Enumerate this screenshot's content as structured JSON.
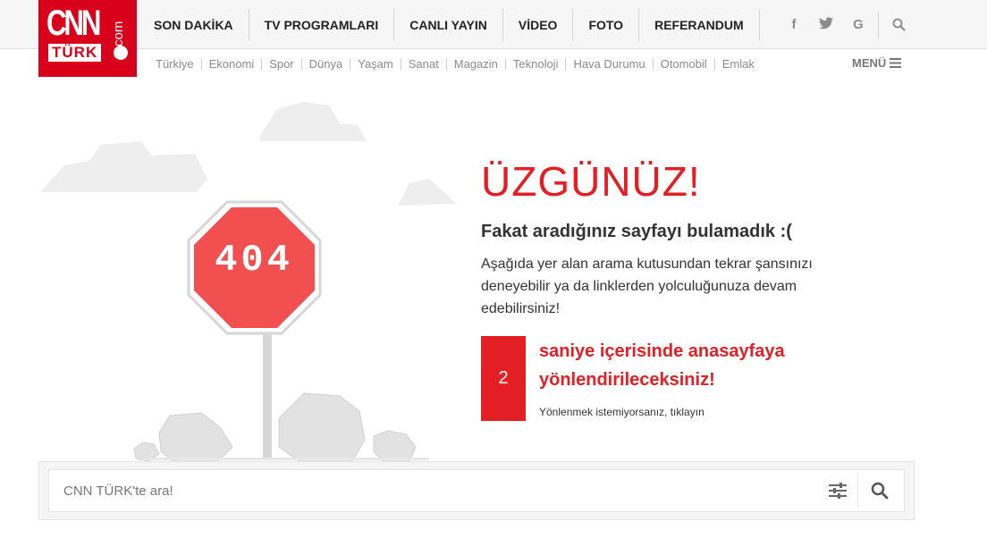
{
  "logo": {
    "text_top": "CNN",
    "text_side": "com",
    "text_bottom": "TÜRK"
  },
  "main_nav": [
    "SON DAKİKA",
    "TV PROGRAMLARI",
    "CANLI YAYIN",
    "VİDEO",
    "FOTO",
    "REFERANDUM"
  ],
  "social": {
    "facebook": "f",
    "twitter": "twitter-icon",
    "google": "G"
  },
  "sub_nav": [
    "Türkiye",
    "Ekonomi",
    "Spor",
    "Dünya",
    "Yaşam",
    "Sanat",
    "Magazin",
    "Teknoloji",
    "Hava Durumu",
    "Otomobil",
    "Emlak"
  ],
  "menu_label": "MENÜ",
  "sign_text": "404",
  "content": {
    "title": "ÜZGÜNÜZ!",
    "subtitle": "Fakat aradığınız sayfayı bulamadık :(",
    "description": "Aşağıda yer alan arama kutusundan tekrar şansınızı deneyebilir ya da linklerden yolculuğunuza devam edebilirsiniz!",
    "countdown": "2",
    "redirect_text": "saniye içerisinde anasayfaya yönlendirileceksiniz!",
    "cancel_text": "Yönlenmek istemiyorsanız, tıklayın"
  },
  "search": {
    "placeholder": "CNN TÜRK'te ara!"
  },
  "colors": {
    "brand": "#d9001b",
    "accent": "#e31e24",
    "sign": "#f25050"
  }
}
